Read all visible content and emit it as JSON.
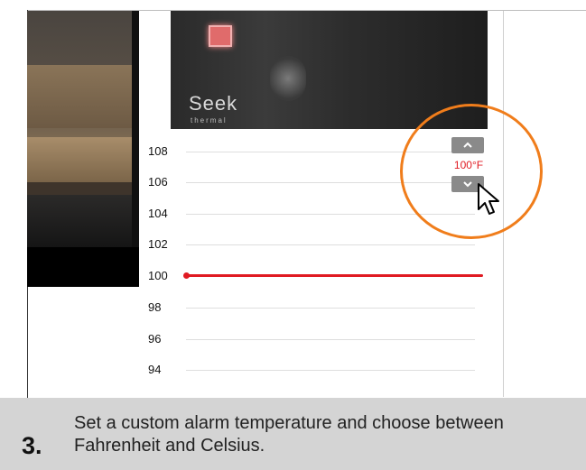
{
  "thermal_view": {
    "logo": "Seek",
    "logo_sub": "thermal"
  },
  "scale": {
    "ticks": [
      "108",
      "106",
      "104",
      "102",
      "100",
      "98",
      "96",
      "94"
    ],
    "alarm_value": "100"
  },
  "alarm_control": {
    "up_label": "^",
    "down_label": "v",
    "set_value": "100°F"
  },
  "caption": {
    "step_number": "3.",
    "text": "Set a custom alarm temperature and choose between Fahrenheit and Celsius."
  },
  "colors": {
    "alarm_line": "#e01a22",
    "highlight_ring": "#f07d1b",
    "caption_bg": "#d4d4d4",
    "button_gray": "#8a8a8a"
  }
}
